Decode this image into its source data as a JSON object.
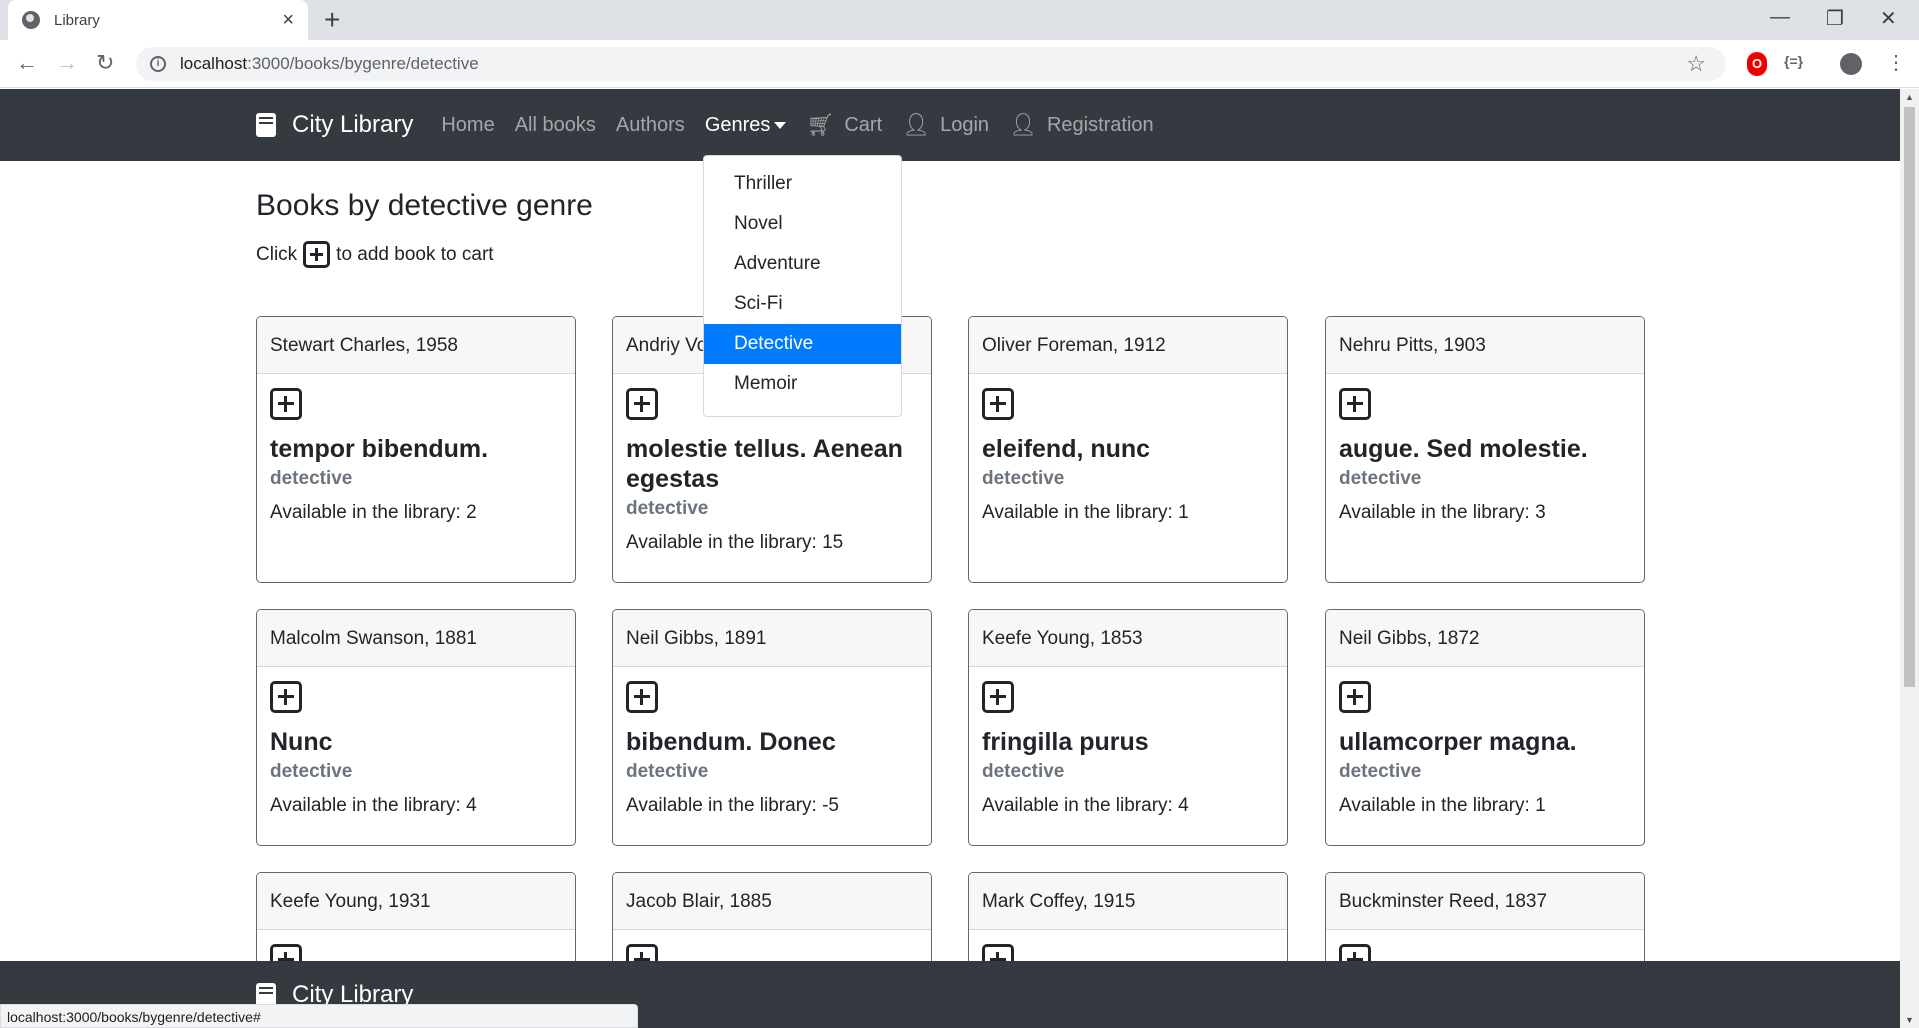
{
  "browser": {
    "tab_title": "Library",
    "url_host": "localhost",
    "url_path": ":3000/books/bygenre/detective",
    "status_url": "localhost:3000/books/bygenre/detective#"
  },
  "navbar": {
    "brand": "City Library",
    "links": [
      "Home",
      "All books",
      "Authors",
      "Genres",
      "Cart",
      "Login",
      "Registration"
    ]
  },
  "dropdown": {
    "items": [
      "Thriller",
      "Novel",
      "Adventure",
      "Sci-Fi",
      "Detective",
      "Memoir"
    ],
    "active": "Detective"
  },
  "main": {
    "heading": "Books by detective genre",
    "hint_prefix": "Click",
    "hint_suffix": "to add book to cart",
    "cards": [
      {
        "header": "Stewart Charles, 1958",
        "title": "tempor bibendum.",
        "genre": "detective",
        "avail": "Available in the library: 2"
      },
      {
        "header": "Andriy Vo",
        "title": "molestie tellus. Aenean egestas",
        "genre": "detective",
        "avail": "Available in the library: 15"
      },
      {
        "header": "Oliver Foreman, 1912",
        "title": "eleifend, nunc",
        "genre": "detective",
        "avail": "Available in the library: 1"
      },
      {
        "header": "Nehru Pitts, 1903",
        "title": "augue. Sed molestie.",
        "genre": "detective",
        "avail": "Available in the library: 3"
      },
      {
        "header": "Malcolm Swanson, 1881",
        "title": "Nunc",
        "genre": "detective",
        "avail": "Available in the library: 4"
      },
      {
        "header": "Neil Gibbs, 1891",
        "title": "bibendum. Donec",
        "genre": "detective",
        "avail": "Available in the library: -5"
      },
      {
        "header": "Keefe Young, 1853",
        "title": "fringilla purus",
        "genre": "detective",
        "avail": "Available in the library: 4"
      },
      {
        "header": "Neil Gibbs, 1872",
        "title": "ullamcorper magna.",
        "genre": "detective",
        "avail": "Available in the library: 1"
      },
      {
        "header": "Keefe Young, 1931",
        "title": "",
        "genre": "",
        "avail": ""
      },
      {
        "header": "Jacob Blair, 1885",
        "title": "",
        "genre": "",
        "avail": ""
      },
      {
        "header": "Mark Coffey, 1915",
        "title": "",
        "genre": "",
        "avail": ""
      },
      {
        "header": "Buckminster Reed, 1837",
        "title": "",
        "genre": "",
        "avail": ""
      }
    ]
  },
  "footer": {
    "brand": "City Library"
  }
}
